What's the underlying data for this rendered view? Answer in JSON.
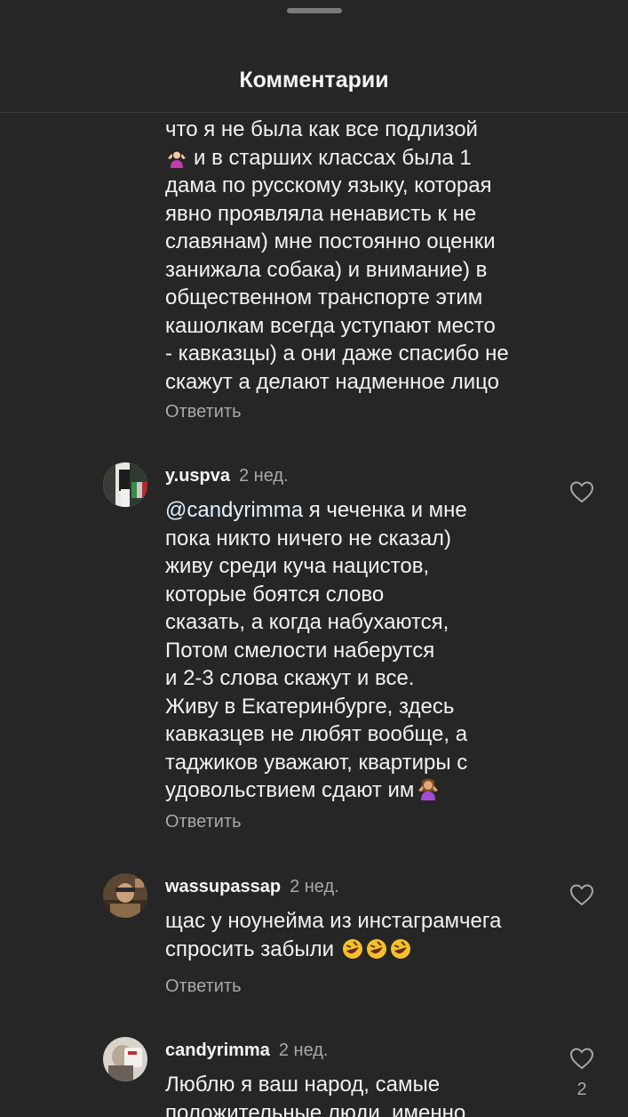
{
  "header": {
    "title": "Комментарии"
  },
  "colors": {
    "background": "#262626",
    "text_primary": "#f5f5f5",
    "text_secondary": "#a8a8a8",
    "mention": "#e0f1ff"
  },
  "comments": [
    {
      "lines": [
        "что я не была как все подлизой",
        "и в старших классах была 1",
        "дама по русскому языку, которая",
        "явно проявляла ненависть к не",
        "славянам) мне постоянно оценки",
        "занижала собака) и внимание) в",
        "общественном транспорте этим",
        "кашолкам всегда уступают место",
        "- кавказцы) а они даже спасибо не",
        "скажут а делают надменное лицо"
      ],
      "emoji_line2": "woman-shrugging-emoji",
      "reply_label": "Ответить"
    },
    {
      "username": "y.uspva",
      "time": "2 нед.",
      "mention": "@candyrimma",
      "first_line_rest": " я чеченка и мне",
      "lines": [
        "пока никто ничего не сказал)",
        "живу среди куча нацистов,",
        "которые боятся слово",
        "сказать, а когда набухаются,",
        "Потом смелости наберутся",
        "и 2-3 слова скажут и все.",
        "Живу в Екатеринбурге, здесь",
        "кавказцев не любят вообще, а",
        "таджиков уважают, квартиры с",
        "удовольствием сдают им"
      ],
      "end_emoji": "woman-shrugging-emoji",
      "reply_label": "Ответить"
    },
    {
      "username": "wassupassap",
      "time": "2 нед.",
      "lines": [
        "щас у ноунейма из инстаграмчега",
        "спросить забыли"
      ],
      "end_emoji": "rolling-on-floor-laughing-emoji x3",
      "reply_label": "Ответить"
    },
    {
      "username": "candyrimma",
      "time": "2 нед.",
      "lines": [
        "Люблю я ваш народ, самые",
        "положительные люди, именно"
      ],
      "like_count": "2"
    }
  ]
}
